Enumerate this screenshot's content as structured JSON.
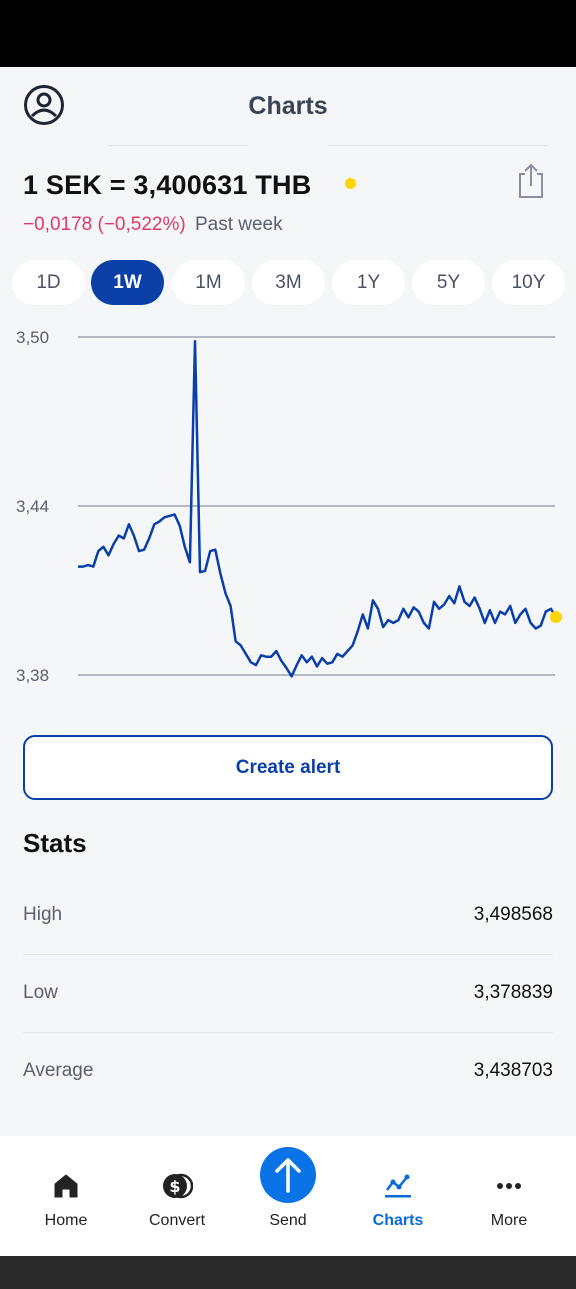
{
  "header": {
    "title": "Charts",
    "profile_icon": "profile-icon",
    "share_icon": "share-icon"
  },
  "rate": {
    "text": "1 SEK = 3,400631 THB",
    "change": "−0,0178 (−0,522%)",
    "period_text": "Past week",
    "live_color": "#ffd400",
    "negative_color": "#e0386a"
  },
  "periods": [
    "1D",
    "1W",
    "1M",
    "3M",
    "1Y",
    "5Y",
    "10Y"
  ],
  "selected_period": "1W",
  "chart_data": {
    "type": "line",
    "title": "",
    "xlabel": "",
    "ylabel": "",
    "y_ticks": [
      "3,50",
      "3,44",
      "3,38"
    ],
    "ylim": [
      3.38,
      3.5
    ],
    "grid": true,
    "series": [
      {
        "color": "#0a3fa8",
        "values": [
          3.4185,
          3.4185,
          3.419,
          3.4185,
          3.424,
          3.4255,
          3.4225,
          3.4265,
          3.4295,
          3.4285,
          3.4335,
          3.4295,
          3.424,
          3.4245,
          3.4285,
          3.4335,
          3.4345,
          3.436,
          3.4365,
          3.437,
          3.433,
          3.4255,
          3.42,
          3.4985,
          3.4165,
          3.417,
          3.424,
          3.4245,
          3.416,
          3.409,
          3.4045,
          3.392,
          3.3905,
          3.3875,
          3.3845,
          3.3835,
          3.387,
          3.3865,
          3.3865,
          3.3885,
          3.385,
          3.3825,
          3.3795,
          3.3835,
          3.387,
          3.3845,
          3.3865,
          3.383,
          3.386,
          3.384,
          3.3845,
          3.3875,
          3.3865,
          3.3885,
          3.3905,
          3.3955,
          3.4015,
          3.3965,
          3.4065,
          3.4035,
          3.397,
          3.3995,
          3.3985,
          3.3995,
          3.4035,
          3.4005,
          3.404,
          3.4025,
          3.3985,
          3.3965,
          3.406,
          3.4035,
          3.405,
          3.408,
          3.4055,
          3.4115,
          3.406,
          3.4045,
          3.4075,
          3.4035,
          3.3985,
          3.403,
          3.3985,
          3.4025,
          3.4015,
          3.4045,
          3.3985,
          3.4015,
          3.4035,
          3.3985,
          3.3965,
          3.3975,
          3.4025,
          3.4035,
          3.4006
        ]
      }
    ]
  },
  "alert_button": "Create alert",
  "stats": {
    "title": "Stats",
    "rows": [
      {
        "label": "High",
        "value": "3,498568"
      },
      {
        "label": "Low",
        "value": "3,378839"
      },
      {
        "label": "Average",
        "value": "3,438703"
      }
    ]
  },
  "nav": [
    {
      "label": "Home",
      "icon": "home-icon"
    },
    {
      "label": "Convert",
      "icon": "convert-icon"
    },
    {
      "label": "Send",
      "icon": "send-arrow-icon"
    },
    {
      "label": "Charts",
      "icon": "charts-icon"
    },
    {
      "label": "More",
      "icon": "more-icon"
    }
  ],
  "colors": {
    "accent": "#0a3fa8",
    "nav_active": "#0a6ad8",
    "send_button": "#0a74e6"
  }
}
